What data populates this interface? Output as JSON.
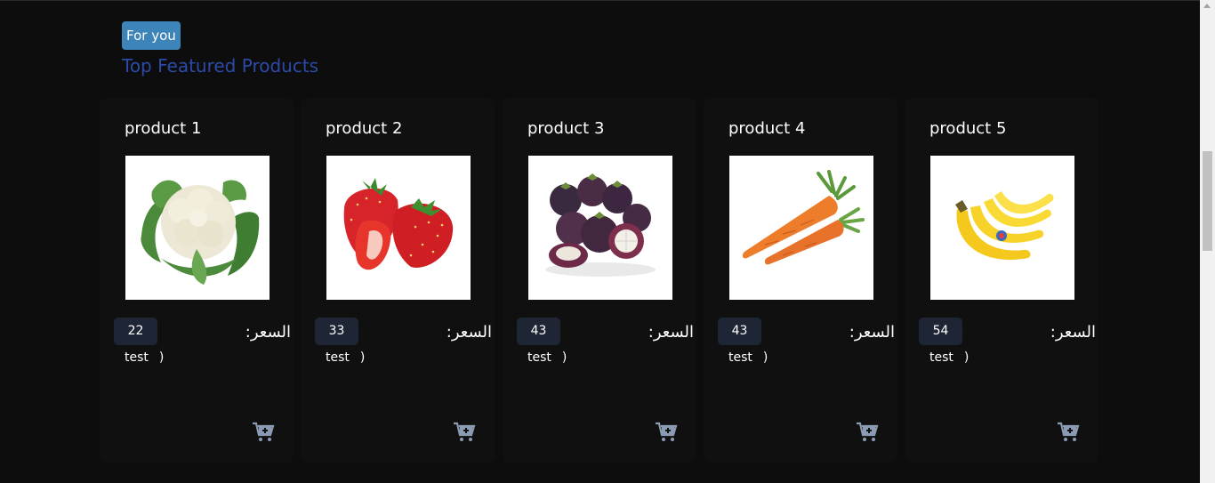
{
  "badge": {
    "label": "For you"
  },
  "section": {
    "title": "Top Featured Products"
  },
  "price_label": "السعر:",
  "products": [
    {
      "name": "product 1",
      "price": "22",
      "description": "test",
      "paren": ")",
      "image": "cauliflower"
    },
    {
      "name": "product 2",
      "price": "33",
      "description": "test",
      "paren": ")",
      "image": "strawberry"
    },
    {
      "name": "product 3",
      "price": "43",
      "description": "test",
      "paren": ")",
      "image": "mangosteen"
    },
    {
      "name": "product 4",
      "price": "43",
      "description": "test",
      "paren": ")",
      "image": "carrot"
    },
    {
      "name": "product 5",
      "price": "54",
      "description": "test",
      "paren": ")",
      "image": "banana"
    }
  ],
  "colors": {
    "background": "#0d0d0d",
    "card": "#101010",
    "badge": "#3d84b8",
    "title": "#2c4aa8",
    "price_chip": "#1e2535",
    "cart_icon": "#8a9bb3"
  },
  "icons": {
    "cart": "add-to-cart-icon"
  }
}
